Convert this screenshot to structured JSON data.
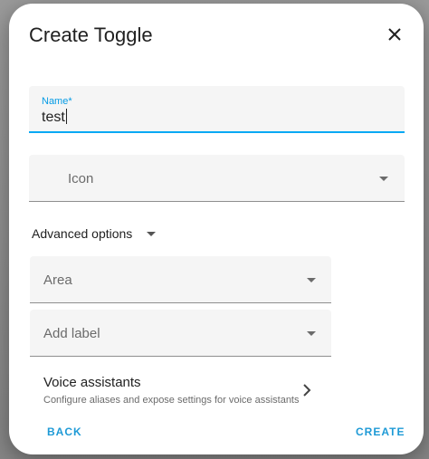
{
  "dialog": {
    "title": "Create Toggle",
    "close_icon": "close-icon"
  },
  "form": {
    "name": {
      "label": "Name*",
      "value": "test"
    },
    "icon": {
      "placeholder": "Icon",
      "icon": "chevron-down-icon"
    },
    "advanced_options": {
      "label": "Advanced options",
      "icon": "chevron-down-icon"
    },
    "area": {
      "placeholder": "Area",
      "icon": "chevron-down-icon"
    },
    "add_label": {
      "placeholder": "Add label",
      "icon": "chevron-down-icon"
    },
    "voice_assistants": {
      "title": "Voice assistants",
      "subtitle": "Configure aliases and expose settings for voice assistants",
      "icon": "chevron-right-icon"
    }
  },
  "actions": {
    "back_label": "BACK",
    "create_label": "CREATE"
  },
  "colors": {
    "accent": "#03a9f4",
    "field_bg": "#f5f5f5",
    "button_text": "#1e9ad6"
  }
}
